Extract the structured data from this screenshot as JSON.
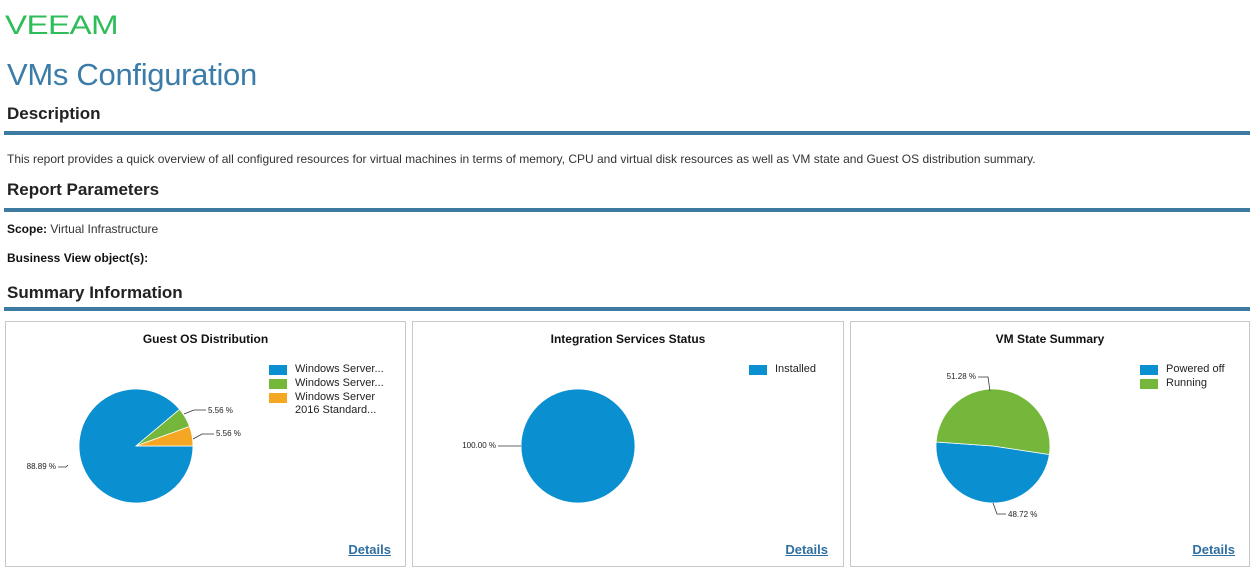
{
  "header": {
    "logo_text": "VEEAM",
    "brand_color": "#2ebd59",
    "title": "VMs Configuration",
    "title_color": "#3b7ca8"
  },
  "sections": {
    "description_title": "Description",
    "description_text": "This report provides a quick overview of all configured resources for virtual machines in terms of memory, CPU and virtual disk resources as well as VM state and Guest OS distribution summary.",
    "parameters_title": "Report Parameters",
    "scope_label": "Scope:",
    "scope_value": "Virtual Infrastructure",
    "business_view_label": "Business View object(s):",
    "summary_title": "Summary Information",
    "rule_color": "#3d7aa1"
  },
  "panels": [
    {
      "title": "Guest OS Distribution",
      "details_label": "Details"
    },
    {
      "title": "Integration Services Status",
      "details_label": "Details"
    },
    {
      "title": "VM State Summary",
      "details_label": "Details"
    }
  ],
  "chart_data": [
    {
      "type": "pie",
      "title": "Guest OS Distribution",
      "categories": [
        "Windows Server...",
        "Windows Server...",
        "Windows Server 2016 Standard..."
      ],
      "values": [
        88.89,
        5.56,
        5.56
      ],
      "labels": [
        "88.89 %",
        "5.56 %",
        "5.56 %"
      ],
      "colors": [
        "#0a8fd0",
        "#74b73a",
        "#f5a623"
      ],
      "legend": "top-right"
    },
    {
      "type": "pie",
      "title": "Integration Services Status",
      "categories": [
        "Installed"
      ],
      "values": [
        100.0
      ],
      "labels": [
        "100.00 %"
      ],
      "colors": [
        "#0a8fd0"
      ],
      "legend": "top-right"
    },
    {
      "type": "pie",
      "title": "VM State Summary",
      "categories": [
        "Powered off",
        "Running"
      ],
      "values": [
        48.72,
        51.28
      ],
      "labels": [
        "48.72 %",
        "51.28 %"
      ],
      "colors": [
        "#0a8fd0",
        "#74b73a"
      ],
      "legend": "top-right"
    }
  ]
}
